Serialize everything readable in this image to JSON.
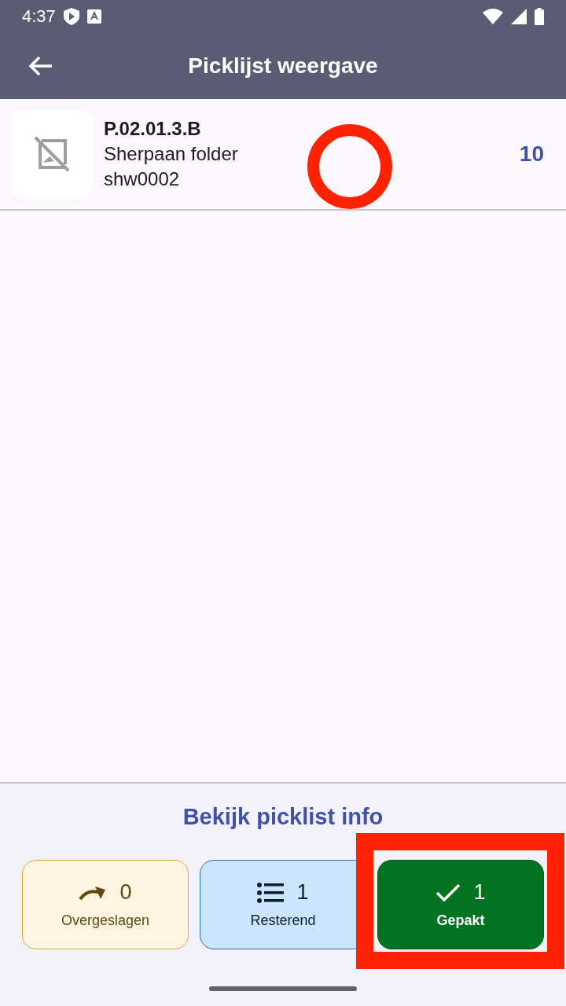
{
  "status_bar": {
    "time": "4:37"
  },
  "app_bar": {
    "title": "Picklijst weergave"
  },
  "items": [
    {
      "location": "P.02.01.3.B",
      "name": "Sherpaan folder",
      "sku": "shw0002",
      "quantity": "10",
      "circled": true
    }
  ],
  "info_link": "Bekijk picklist info",
  "counters": [
    {
      "kind": "skipped",
      "count": "0",
      "label": "Overgeslagen",
      "selected": false,
      "framed": false
    },
    {
      "kind": "remaining",
      "count": "1",
      "label": "Resterend",
      "selected": false,
      "framed": false
    },
    {
      "kind": "picked",
      "count": "1",
      "label": "Gepakt",
      "selected": true,
      "framed": true
    }
  ]
}
